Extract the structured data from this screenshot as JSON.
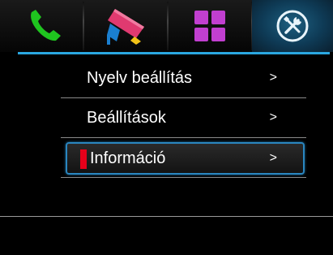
{
  "tabs": [
    {
      "icon": "phone-icon"
    },
    {
      "icon": "camera-icon"
    },
    {
      "icon": "grid-icon"
    },
    {
      "icon": "tools-icon",
      "active": true
    }
  ],
  "menu": {
    "items": [
      {
        "label": "Nyelv beállítás",
        "arrow": ">"
      },
      {
        "label": "Beállítások",
        "arrow": ">"
      },
      {
        "label": "Információ",
        "arrow": ">",
        "selected": true
      }
    ]
  },
  "colors": {
    "accent": "#2aa7e0",
    "phone": "#1fc51f",
    "camera": "#e03a70",
    "grid": "#c13fd0",
    "cursor": "#e6001a"
  }
}
